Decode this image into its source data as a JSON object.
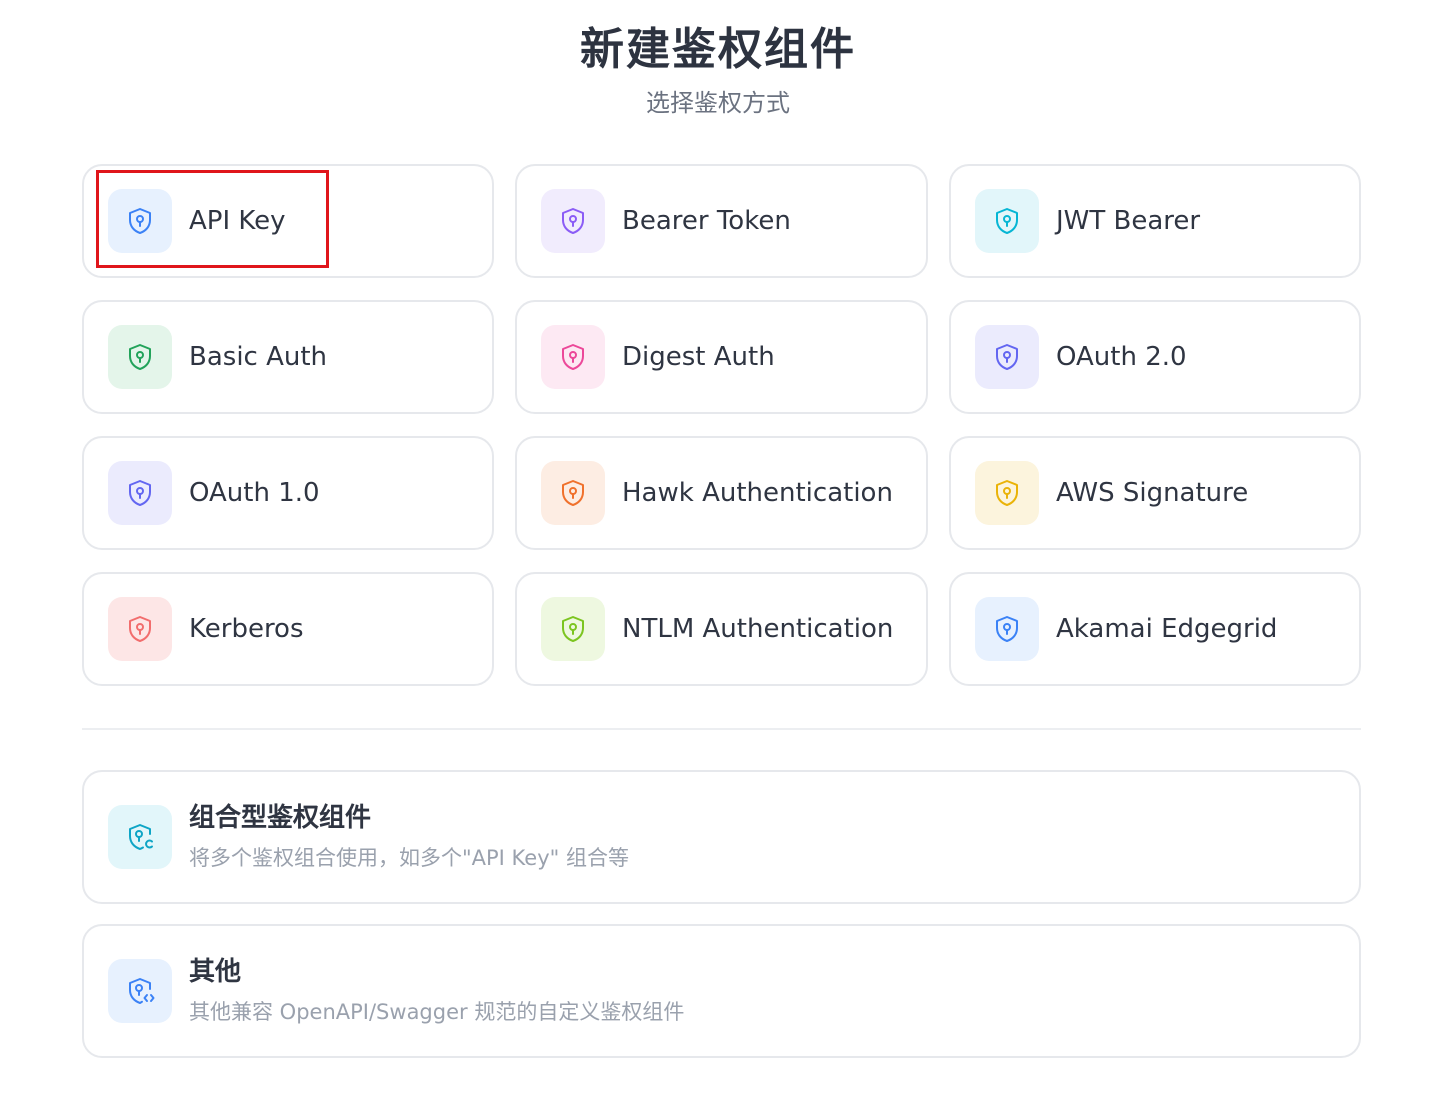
{
  "header": {
    "title": "新建鉴权组件",
    "subtitle": "选择鉴权方式"
  },
  "auth_types": [
    {
      "label": "API Key",
      "icon": "shield-icon",
      "color": "#3b82f6",
      "bg": "#e7f1fe"
    },
    {
      "label": "Bearer Token",
      "icon": "shield-icon",
      "color": "#8b5cf6",
      "bg": "#f1ecfd"
    },
    {
      "label": "JWT Bearer",
      "icon": "shield-icon",
      "color": "#06b6d4",
      "bg": "#e2f6fa"
    },
    {
      "label": "Basic Auth",
      "icon": "shield-icon",
      "color": "#22a35a",
      "bg": "#e4f5ea"
    },
    {
      "label": "Digest Auth",
      "icon": "shield-icon",
      "color": "#ec4899",
      "bg": "#fde9f3"
    },
    {
      "label": "OAuth 2.0",
      "icon": "shield-icon",
      "color": "#6366f1",
      "bg": "#ebebfd"
    },
    {
      "label": "OAuth 1.0",
      "icon": "shield-icon",
      "color": "#6366f1",
      "bg": "#ebebfd"
    },
    {
      "label": "Hawk Authentication",
      "icon": "shield-icon",
      "color": "#f0712c",
      "bg": "#fdede3"
    },
    {
      "label": "AWS Signature",
      "icon": "shield-icon",
      "color": "#eab308",
      "bg": "#fcf4dd"
    },
    {
      "label": "Kerberos",
      "icon": "shield-icon",
      "color": "#f26d6d",
      "bg": "#fde6e6"
    },
    {
      "label": "NTLM Authentication",
      "icon": "shield-icon",
      "color": "#7cc520",
      "bg": "#eef8e0"
    },
    {
      "label": "Akamai Edgegrid",
      "icon": "shield-icon",
      "color": "#3b82f6",
      "bg": "#e7f1fe"
    }
  ],
  "combined": {
    "title": "组合型鉴权组件",
    "description": "将多个鉴权组合使用，如多个\"API Key\" 组合等",
    "icon": "shield-combined-icon",
    "color": "#0ea5c6",
    "bg": "#e2f6fa"
  },
  "other": {
    "title": "其他",
    "description": "其他兼容 OpenAPI/Swagger 规范的自定义鉴权组件",
    "icon": "shield-code-icon",
    "color": "#3b82f6",
    "bg": "#e7f1fe"
  },
  "selected": "API Key"
}
